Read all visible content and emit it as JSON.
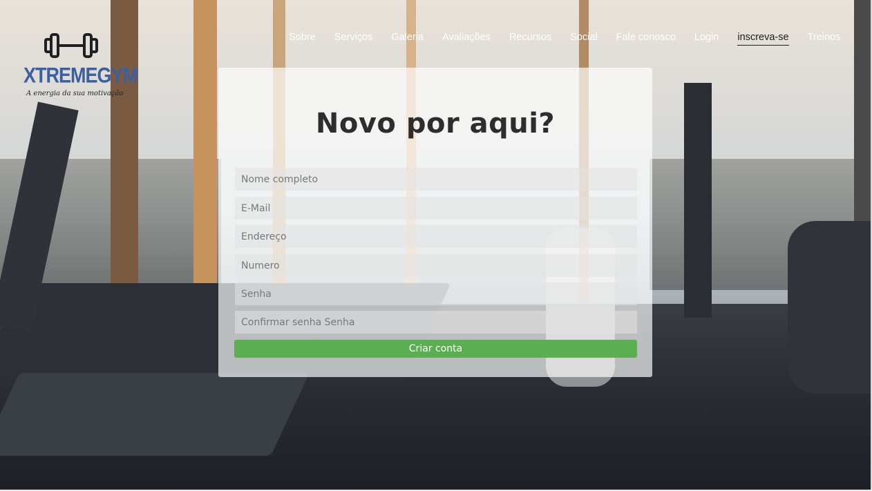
{
  "brand": {
    "name": "XTREMEGYM",
    "tagline": "A energia da sua motivação",
    "name_color": "#3c5fa0"
  },
  "nav": {
    "items": [
      {
        "label": "Sobre"
      },
      {
        "label": "Serviços"
      },
      {
        "label": "Galeria"
      },
      {
        "label": "Avaliações"
      },
      {
        "label": "Recursos"
      },
      {
        "label": "Social"
      },
      {
        "label": "Fale conosco"
      },
      {
        "label": "Login"
      },
      {
        "label": "inscreva-se",
        "active": true
      },
      {
        "label": "Treinos"
      }
    ]
  },
  "form": {
    "title": "Novo por aqui?",
    "fields": {
      "full_name": {
        "placeholder": "Nome completo",
        "value": ""
      },
      "email": {
        "placeholder": "E-Mail",
        "value": ""
      },
      "address": {
        "placeholder": "Endereço",
        "value": ""
      },
      "number": {
        "placeholder": "Numero",
        "value": ""
      },
      "password": {
        "placeholder": "Senha",
        "value": ""
      },
      "confirm_password": {
        "placeholder": "Confirmar senha Senha",
        "value": ""
      }
    },
    "submit_label": "Criar conta",
    "submit_color": "#5cae53"
  },
  "icons": {
    "logo": "dumbbell-icon"
  }
}
